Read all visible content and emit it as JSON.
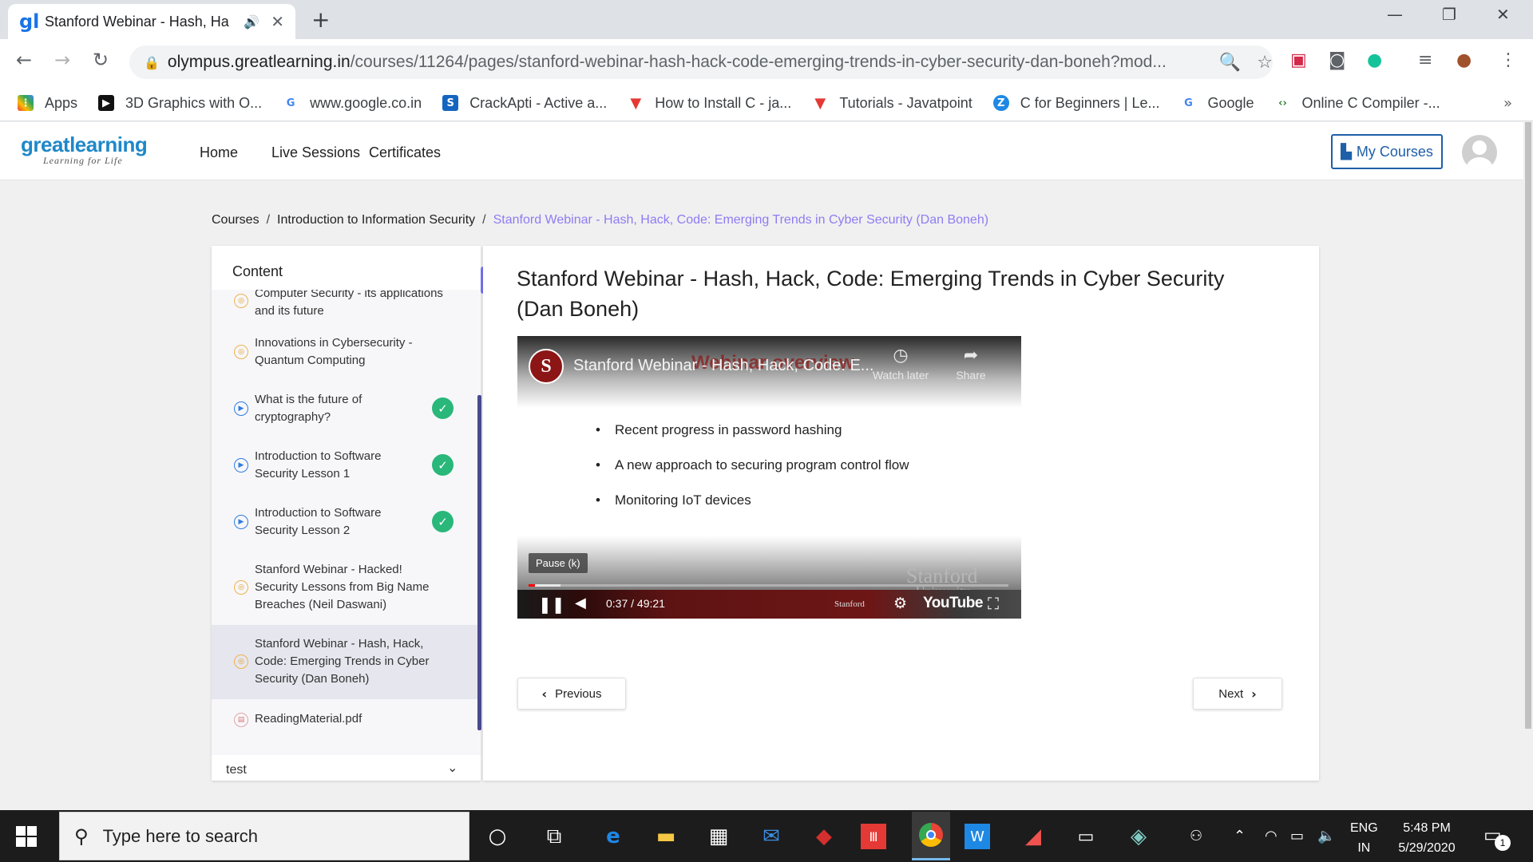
{
  "browser": {
    "tab_title": "Stanford Webinar - Hash, Ha",
    "url_domain": "olympus.greatlearning.in",
    "url_path": "/courses/11264/pages/stanford-webinar-hash-hack-code-emerging-trends-in-cyber-security-dan-boneh?mod...",
    "bookmarks": [
      {
        "label": "Apps",
        "color": "#ea4335",
        "glyph": "⋮"
      },
      {
        "label": "3D Graphics with O...",
        "color": "#111111",
        "glyph": "▶"
      },
      {
        "label": "www.google.co.in",
        "color": "#4285f4",
        "glyph": "G"
      },
      {
        "label": "CrackApti - Active a...",
        "color": "#1565c0",
        "glyph": "S"
      },
      {
        "label": "How to Install C - ja...",
        "color": "#e53935",
        "glyph": "▼"
      },
      {
        "label": "Tutorials - Javatpoint",
        "color": "#e53935",
        "glyph": "▼"
      },
      {
        "label": "C for Beginners | Le...",
        "color": "#1e88e5",
        "glyph": "Z"
      },
      {
        "label": "Google",
        "color": "#4285f4",
        "glyph": "G"
      },
      {
        "label": "Online C Compiler -...",
        "color": "#2e7d32",
        "glyph": "‹›"
      }
    ]
  },
  "site": {
    "logo": "greatlearning",
    "logo_tagline": "Learning for Life",
    "nav": [
      "Home",
      "Live Sessions",
      "Certificates"
    ],
    "my_courses": "My Courses"
  },
  "breadcrumb": {
    "items": [
      "Courses",
      "Introduction to Information Security"
    ],
    "current": "Stanford Webinar - Hash, Hack, Code: Emerging Trends in Cyber Security (Dan Boneh)"
  },
  "sidebar": {
    "heading": "Content",
    "items": [
      {
        "text": "Computer Security - its applications and its future",
        "type": "web",
        "done": false
      },
      {
        "text": "Innovations in Cybersecurity - Quantum Computing",
        "type": "web",
        "done": false
      },
      {
        "text": "What is the future of cryptography?",
        "type": "video",
        "done": true
      },
      {
        "text": "Introduction to Software Security Lesson 1",
        "type": "video",
        "done": true
      },
      {
        "text": "Introduction to Software Security Lesson 2",
        "type": "video",
        "done": true
      },
      {
        "text": "Stanford Webinar - Hacked! Security Lessons from Big Name Breaches (Neil Daswani)",
        "type": "web",
        "done": false
      },
      {
        "text": "Stanford Webinar - Hash, Hack, Code: Emerging Trends in Cyber Security (Dan Boneh)",
        "type": "web",
        "done": false,
        "active": true
      },
      {
        "text": "ReadingMaterial.pdf",
        "type": "pdf",
        "done": false
      }
    ],
    "next_section": "test"
  },
  "main": {
    "title": "Stanford Webinar - Hash, Hack, Code: Emerging Trends in Cyber Security (Dan Boneh)",
    "video": {
      "channel_title": "Stanford Webinar - Hash, Hack, Code: E...",
      "slide_title": "Webinar overview",
      "watch_later": "Watch later",
      "share": "Share",
      "bullets": [
        "Recent progress in password hashing",
        "A new approach to securing program control flow",
        "Monitoring IoT devices"
      ],
      "pause_tooltip": "Pause (k)",
      "time": "0:37 / 49:21",
      "progress_fraction": 0.0125,
      "watermark": "Stanford",
      "watermark_sub": "University",
      "footer_brand": "Stanford",
      "youtube": "YouTube"
    },
    "prev_label": "Previous",
    "next_label": "Next"
  },
  "taskbar": {
    "search_placeholder": "Type here to search",
    "lang_top": "ENG",
    "lang_bottom": "IN",
    "time": "5:48 PM",
    "date": "5/29/2020",
    "notifications": "1"
  }
}
